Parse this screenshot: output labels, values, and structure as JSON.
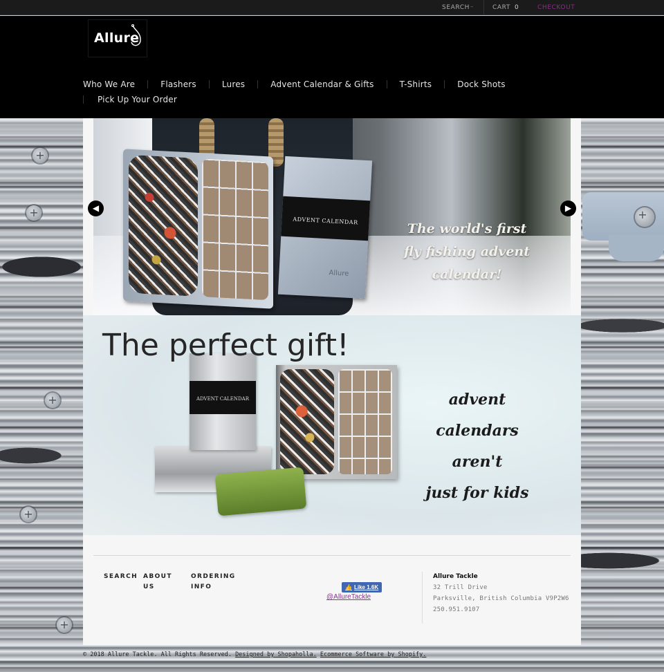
{
  "topbar": {
    "search_label": "SEARCH",
    "search_caret": "–",
    "cart_label": "CART",
    "cart_count": "0",
    "checkout_label": "CHECKOUT",
    "checkout_color": "#8e2b8a"
  },
  "header": {
    "logo_text": "Allure",
    "nav_row1": [
      {
        "label": "Who We Are"
      },
      {
        "label": "Flashers"
      },
      {
        "label": "Lures"
      },
      {
        "label": "Advent Calendar & Gifts"
      },
      {
        "label": "T-Shirts"
      },
      {
        "label": "Dock Shots"
      }
    ],
    "nav_row2": [
      {
        "label": "Pick Up Your Order"
      }
    ]
  },
  "slider": {
    "caption_line1": "The world's first",
    "caption_line2": "fly fishing advent calendar!",
    "calendar_band_text": "ADVENT CALENDAR",
    "calendar_brand": "Allure",
    "prev_icon": "◀",
    "next_icon": "▶"
  },
  "promo": {
    "title": "The perfect gift!",
    "caption_line1": "advent calendars",
    "caption_line2": "aren't",
    "caption_line3": "just for kids",
    "tin_band_text": "ADVENT CALENDAR"
  },
  "footer": {
    "links": [
      {
        "label": "SEARCH"
      },
      {
        "label": "ABOUT\nUS"
      },
      {
        "label": "ORDERING\nINFO"
      }
    ],
    "fb_like_label": "Like",
    "fb_like_count": "1.6K",
    "fb_handle": "@AllureTackle",
    "address": {
      "name": "Allure Tackle",
      "street": "32 Trill Drive",
      "city": "Parksville, British Columbia V9P2W6",
      "phone": "250.951.9107"
    }
  },
  "copyright": {
    "text": "© 2018 Allure Tackle. All Rights Reserved.",
    "designed_by": "Designed by Shopaholla.",
    "ecommerce": "Ecommerce Software by Shopify."
  }
}
